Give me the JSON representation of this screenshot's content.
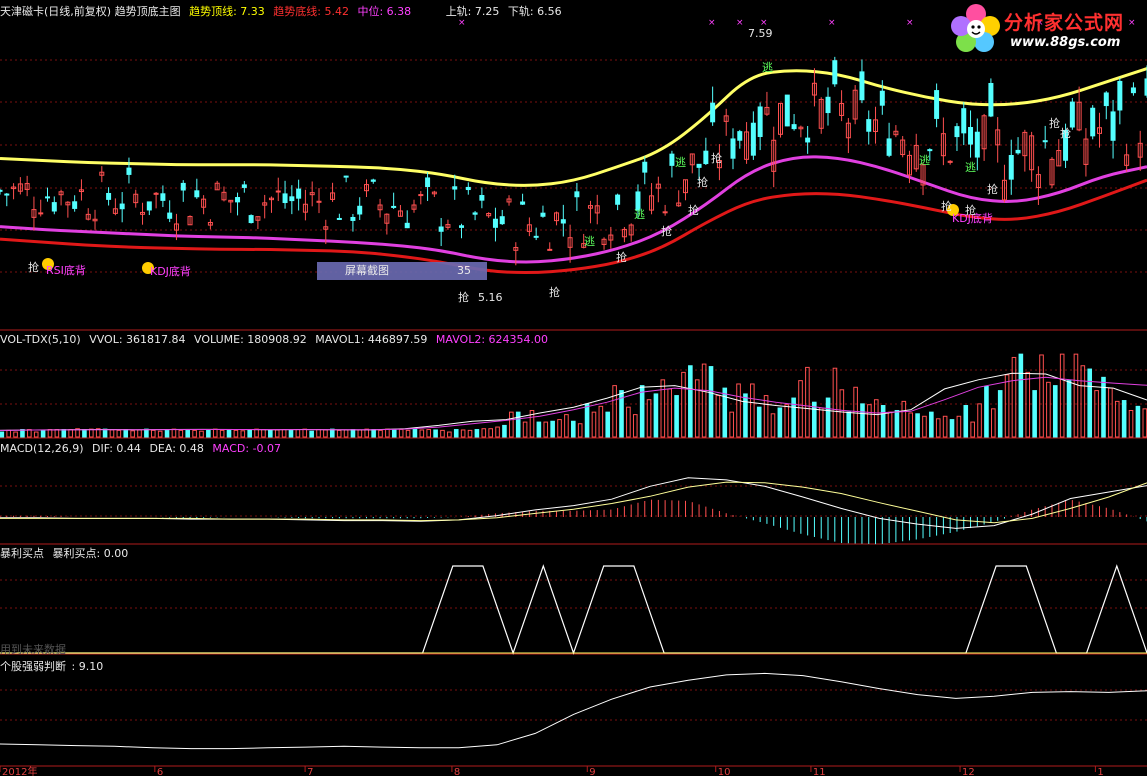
{
  "main_header": {
    "title": "天津磁卡(日线,前复权) 趋势顶底主图",
    "top_line": "趋势顶线: 7.33",
    "bottom_line": "趋势底线: 5.42",
    "middle": "中位: 6.38",
    "upper_rail": "上轨: 7.25",
    "lower_rail": "下轨: 6.56"
  },
  "logo": {
    "name": "分析家公式网",
    "url": "www.88gs.com"
  },
  "screenshot_tip": {
    "label": "屏幕截图",
    "value": "35"
  },
  "price_annotations": {
    "high": "7.59",
    "low": "5.16",
    "kdj_divergence": "KDJ底背",
    "rsi_divergence": "RSI底背",
    "buy_mark": "抢",
    "sell_mark": "逃"
  },
  "vol_header": {
    "name": "VOL-TDX(5,10)",
    "vvol": "VVOL: 361817.84",
    "volume": "VOLUME: 180908.92",
    "mavol1": "MAVOL1: 446897.59",
    "mavol2": "MAVOL2: 624354.00"
  },
  "macd_header": {
    "name": "MACD(12,26,9)",
    "dif": "DIF: 0.44",
    "dea": "DEA: 0.48",
    "macd": "MACD: -0.07"
  },
  "buy_header": {
    "name": "暴利买点",
    "value": "暴利买点: 0.00",
    "note": "用到未来数据"
  },
  "strength_header": {
    "name": "个股强弱判断",
    "value": ": 9.10"
  },
  "x_axis": {
    "labels": [
      {
        "text": "2012年",
        "at": 0
      },
      {
        "text": "6",
        "at": 0.135
      },
      {
        "text": "7",
        "at": 0.266
      },
      {
        "text": "8",
        "at": 0.394
      },
      {
        "text": "9",
        "at": 0.512
      },
      {
        "text": "10",
        "at": 0.624
      },
      {
        "text": "11",
        "at": 0.707
      },
      {
        "text": "12",
        "at": 0.837
      },
      {
        "text": "1",
        "at": 0.955
      }
    ]
  },
  "colors": {
    "top_line": "#ffff66",
    "middle_line": "#e040e0",
    "bottom_line": "#e01818",
    "up_candle": "#ff5050",
    "down_candle": "#54ffff",
    "grid": "#7a1010",
    "separator": "#b01c1c",
    "white_line": "#ffffff"
  },
  "chart_data": [
    {
      "type": "line",
      "title": "趋势顶底主图",
      "series": [
        {
          "name": "趋势顶线",
          "values": [
            6.46,
            6.44,
            6.42,
            6.41,
            6.4,
            6.4,
            6.4,
            6.39,
            6.38,
            6.36,
            6.31,
            6.22,
            6.19,
            6.24,
            6.38,
            6.53,
            6.86,
            7.27,
            7.32,
            7.28,
            7.15,
            7.05,
            6.98,
            6.98,
            7.05,
            7.19,
            7.33
          ]
        },
        {
          "name": "中位",
          "values": [
            5.8,
            5.77,
            5.75,
            5.73,
            5.71,
            5.7,
            5.69,
            5.67,
            5.65,
            5.62,
            5.57,
            5.48,
            5.45,
            5.49,
            5.58,
            5.74,
            6.01,
            6.34,
            6.48,
            6.47,
            6.37,
            6.22,
            6.07,
            6.03,
            6.12,
            6.29,
            6.38
          ]
        },
        {
          "name": "趋势底线",
          "values": [
            5.68,
            5.65,
            5.62,
            5.6,
            5.59,
            5.58,
            5.58,
            5.57,
            5.56,
            5.52,
            5.46,
            5.37,
            5.35,
            5.38,
            5.45,
            5.59,
            5.84,
            6.05,
            6.12,
            6.12,
            6.06,
            5.98,
            5.89,
            5.86,
            5.94,
            6.09,
            6.25
          ]
        }
      ],
      "ylim": [
        4.8,
        7.8
      ]
    },
    {
      "type": "bar",
      "title": "VOL-TDX(5,10)",
      "series": [
        {
          "name": "VOLUME",
          "values": [
            60000,
            80000,
            60000,
            90000,
            90000,
            60000,
            80000,
            90000,
            90000,
            90000,
            90000,
            100000,
            90000,
            95000,
            100000,
            95000,
            85000,
            80000,
            90000,
            75000,
            85000,
            95000,
            80000,
            70000,
            90000,
            95000,
            80000,
            90000,
            80000,
            70000,
            80000,
            95000,
            80000,
            90000,
            80000,
            75000,
            85000,
            95000,
            90000,
            80000,
            85000,
            90000,
            80000,
            90000,
            95000,
            70000,
            90000,
            85000,
            95000,
            80000,
            85000,
            90000,
            85000,
            95000,
            90000,
            80000,
            95000,
            85000,
            90000,
            80000,
            95000,
            85000,
            90000,
            85000,
            80000,
            60000,
            90000,
            85000,
            80000,
            90000,
            100000,
            100000,
            120000,
            140000,
            300000,
            300000,
            180000,
            320000,
            180000,
            180000,
            190000,
            210000,
            270000,
            190000,
            160000,
            400000,
            300000,
            370000,
            300000,
            620000,
            560000,
            360000,
            270000,
            620000,
            450000,
            520000,
            690000,
            580000,
            500000,
            780000,
            860000,
            690000,
            880000,
            850000,
            500000,
            590000,
            300000,
            640000,
            520000,
            640000,
            360000,
            500000,
            280000,
            350000,
            390000,
            470000,
            680000,
            840000,
            420000,
            350000,
            470000,
            830000,
            570000,
            300000,
            600000,
            400000,
            390000,
            450000,
            380000,
            300000,
            320000,
            430000,
            290000,
            280000,
            250000,
            300000,
            220000,
            250000,
            210000,
            250000,
            380000,
            180000,
            400000,
            610000,
            340000,
            560000,
            750000,
            960000,
            1000000,
            780000,
            560000,
            990000,
            660000,
            620000,
            1000000,
            680000,
            1000000,
            860000,
            820000,
            560000,
            720000,
            590000,
            430000,
            440000,
            320000,
            370000,
            340000
          ]
        },
        {
          "name": "MAVOL1",
          "values": [
            80000,
            85000,
            88000,
            90000,
            88000,
            90000,
            92000,
            90000,
            88000,
            90000,
            88000,
            86000,
            100000,
            140000,
            190000,
            210000,
            290000,
            360000,
            470000,
            600000,
            620000,
            540000,
            430000,
            380000,
            340000,
            300000,
            270000,
            330000,
            580000,
            690000,
            770000,
            760000,
            620000,
            590000,
            446898
          ]
        },
        {
          "name": "MAVOL2",
          "values": [
            80000,
            84000,
            86000,
            88000,
            88000,
            89000,
            90000,
            90000,
            89000,
            89000,
            88000,
            87000,
            95000,
            120000,
            160000,
            200000,
            250000,
            330000,
            420000,
            540000,
            590000,
            560000,
            480000,
            420000,
            370000,
            320000,
            290000,
            310000,
            450000,
            600000,
            680000,
            720000,
            680000,
            650000,
            624354
          ]
        }
      ]
    },
    {
      "type": "line",
      "title": "MACD(12,26,9)",
      "series": [
        {
          "name": "DIF",
          "values": [
            -0.01,
            -0.01,
            -0.02,
            -0.02,
            -0.02,
            -0.03,
            -0.03,
            -0.03,
            -0.04,
            -0.05,
            -0.05,
            -0.06,
            -0.04,
            0.02,
            0.1,
            0.16,
            0.25,
            0.43,
            0.55,
            0.52,
            0.43,
            0.28,
            0.12,
            -0.02,
            -0.1,
            -0.16,
            -0.12,
            0.04,
            0.26,
            0.35,
            0.44
          ]
        },
        {
          "name": "DEA",
          "values": [
            -0.02,
            -0.02,
            -0.02,
            -0.02,
            -0.02,
            -0.02,
            -0.03,
            -0.03,
            -0.03,
            -0.04,
            -0.04,
            -0.05,
            -0.04,
            -0.01,
            0.05,
            0.11,
            0.19,
            0.29,
            0.42,
            0.49,
            0.48,
            0.42,
            0.33,
            0.2,
            0.08,
            -0.04,
            -0.08,
            -0.02,
            0.12,
            0.28,
            0.48
          ]
        },
        {
          "name": "MACD",
          "values": [
            0.02,
            0.02,
            0.0,
            0.0,
            0.0,
            -0.02,
            0.0,
            0.0,
            -0.02,
            -0.02,
            -0.02,
            -0.02,
            0.0,
            0.06,
            0.1,
            0.1,
            0.12,
            0.28,
            0.26,
            0.06,
            -0.1,
            -0.28,
            -0.42,
            -0.44,
            -0.36,
            -0.24,
            -0.08,
            0.12,
            0.28,
            0.14,
            -0.07
          ]
        }
      ]
    },
    {
      "type": "line",
      "title": "暴利买点",
      "series": [
        {
          "name": "暴利买点",
          "values": [
            0,
            0,
            0,
            0,
            0,
            0,
            0,
            0,
            0,
            0,
            0,
            0,
            0,
            0,
            0,
            1,
            1,
            0,
            1,
            0,
            1,
            1,
            0,
            0,
            0,
            0,
            0,
            0,
            0,
            0,
            0,
            0,
            0,
            1,
            1,
            0,
            0,
            1,
            0
          ]
        }
      ],
      "ylim": [
        0,
        1
      ]
    },
    {
      "type": "line",
      "title": "个股强弱判断",
      "series": [
        {
          "name": "个股强弱判断",
          "values": [
            2.1,
            2.0,
            1.9,
            1.8,
            1.6,
            1.5,
            1.5,
            1.6,
            1.7,
            1.8,
            1.7,
            1.6,
            1.6,
            2.0,
            3.5,
            6.0,
            8.0,
            9.6,
            10.5,
            11.2,
            11.4,
            11.1,
            10.3,
            9.4,
            8.6,
            8.1,
            8.4,
            8.9,
            9.0,
            8.9,
            9.1
          ]
        }
      ]
    }
  ]
}
